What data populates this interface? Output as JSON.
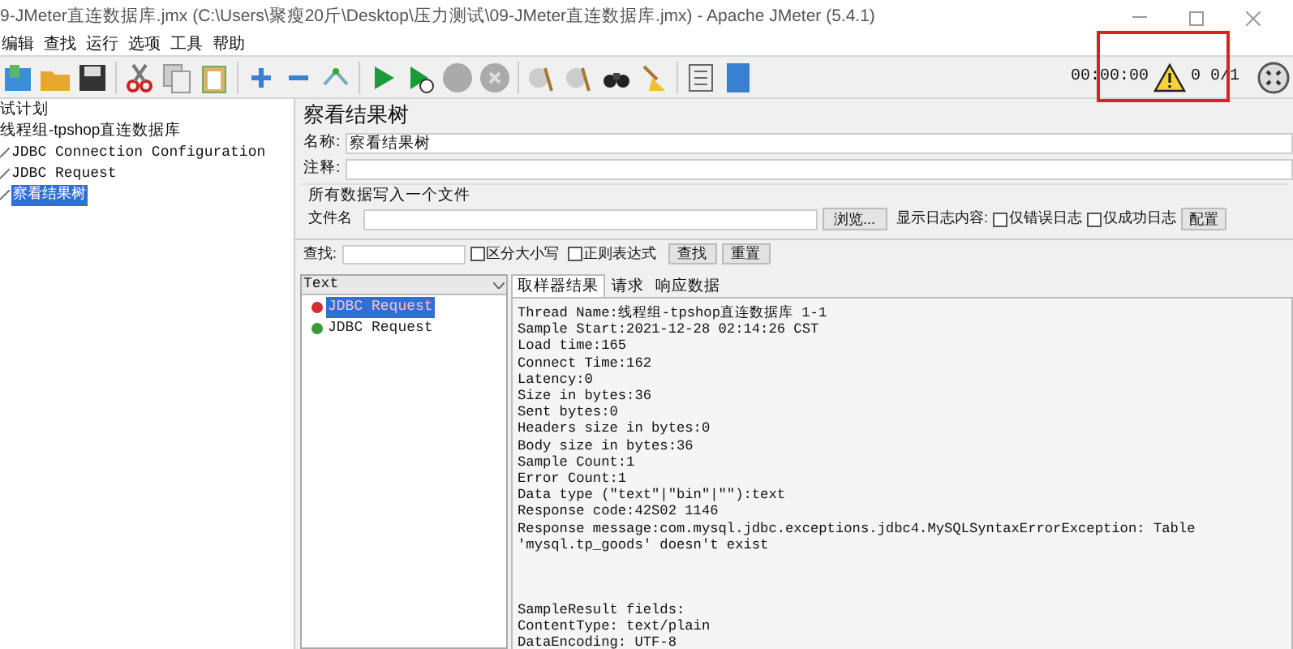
{
  "window": {
    "title": "9-JMeter直连数据库.jmx (C:\\Users\\聚瘦20斤\\Desktop\\压力测试\\09-JMeter直连数据库.jmx) - Apache JMeter (5.4.1)"
  },
  "menu": [
    "编辑",
    "查找",
    "运行",
    "选项",
    "工具",
    "帮助"
  ],
  "status": {
    "timer": "00:00:00",
    "counts": "0 0/1"
  },
  "tree": [
    {
      "label": "试计划",
      "selected": false,
      "children": [
        {
          "label": "线程组-tpshop直连数据库",
          "selected": false,
          "children": [
            {
              "label": "JDBC Connection Configuration",
              "selected": false
            },
            {
              "label": "JDBC Request",
              "selected": false
            },
            {
              "label": "察看结果树",
              "selected": true
            }
          ]
        }
      ]
    }
  ],
  "panel": {
    "title": "察看结果树",
    "name_label": "名称:",
    "name_value": "察看结果树",
    "comment_label": "注释:",
    "file_section": "所有数据写入一个文件",
    "file_label": "文件名",
    "browse": "浏览...",
    "log_label": "显示日志内容:",
    "log_options": [
      {
        "label": "仅错误日志",
        "checked": false
      },
      {
        "label": "仅成功日志",
        "checked": false
      }
    ],
    "config": "配置"
  },
  "search": {
    "label": "查找:",
    "options": [
      {
        "label": "区分大小写",
        "checked": false
      },
      {
        "label": "正则表达式",
        "checked": false
      }
    ],
    "buttons": [
      "查找",
      "重置"
    ]
  },
  "renderer": "Text",
  "results": [
    {
      "label": "JDBC Request",
      "success": false,
      "selected": true
    },
    {
      "label": "JDBC Request",
      "success": true,
      "selected": false
    }
  ],
  "tabs": [
    {
      "label": "取样器结果",
      "selected": true
    },
    {
      "label": "请求",
      "selected": false
    },
    {
      "label": "响应数据",
      "selected": false
    }
  ],
  "sample_result": [
    [
      "Thread Name:线程组-tpshop直连数据库 1-1",
      "Sample Start:2021-12-28 02:14:26 CST",
      "Load time:165",
      "Connect Time:162",
      "Latency:0",
      "Size in bytes:36",
      "Sent bytes:0",
      "Headers size in bytes:0",
      "Body size in bytes:36",
      "Sample Count:1",
      "Error Count:1",
      "Data type (\"text\"|\"bin\"|\"\"):text",
      "Response code:42S02 1146",
      "Response message:com.mysql.jdbc.exceptions.jdbc4.MySQLSyntaxErrorException: Table 'mysql.tp_goods' doesn't exist"
    ],
    [
      "SampleResult fields:",
      "ContentType: text/plain",
      "DataEncoding: UTF-8"
    ]
  ]
}
